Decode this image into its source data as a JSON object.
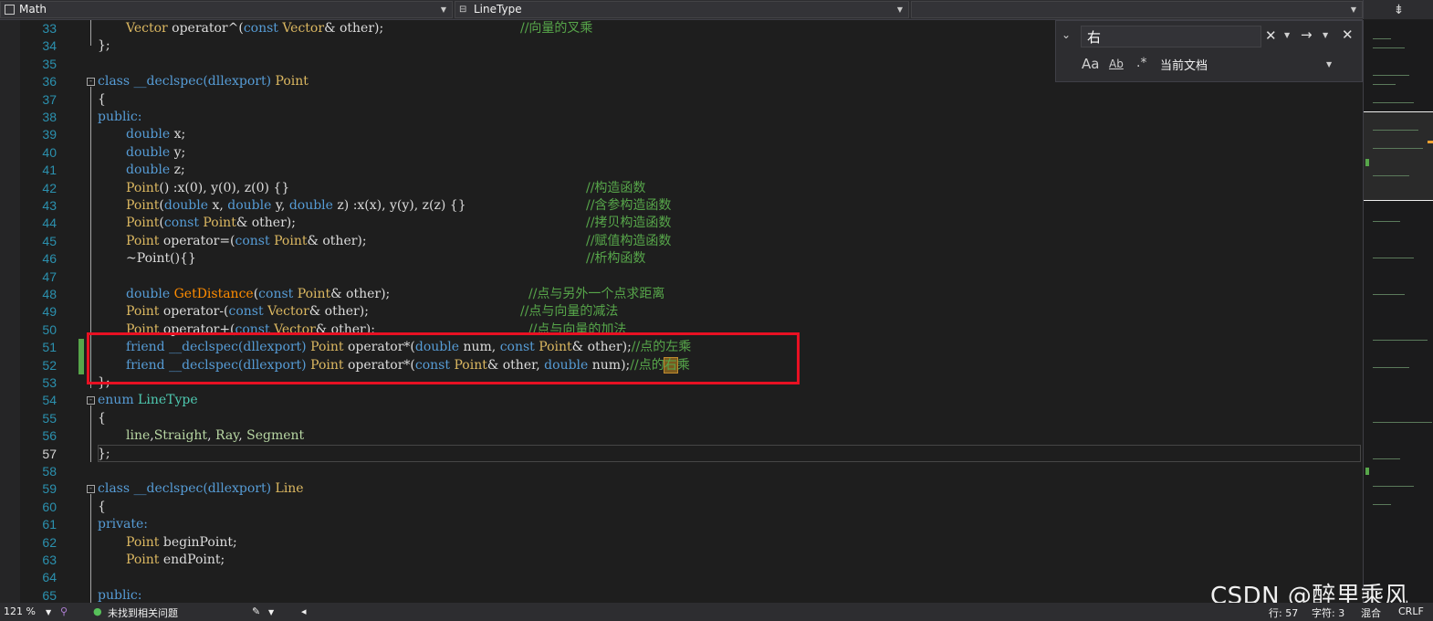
{
  "nav": {
    "left_dropdown": "Math",
    "middle_dropdown": "LineType"
  },
  "find": {
    "query": "右",
    "scope": "当前文档",
    "match_case_icon": "Aa",
    "match_word_icon": "Ab",
    "regex_icon": ".*"
  },
  "lines": [
    {
      "n": "33"
    },
    {
      "n": "34"
    },
    {
      "n": "35"
    },
    {
      "n": "36"
    },
    {
      "n": "37"
    },
    {
      "n": "38"
    },
    {
      "n": "39"
    },
    {
      "n": "40"
    },
    {
      "n": "41"
    },
    {
      "n": "42"
    },
    {
      "n": "43"
    },
    {
      "n": "44"
    },
    {
      "n": "45"
    },
    {
      "n": "46"
    },
    {
      "n": "47"
    },
    {
      "n": "48"
    },
    {
      "n": "49"
    },
    {
      "n": "50"
    },
    {
      "n": "51"
    },
    {
      "n": "52"
    },
    {
      "n": "53"
    },
    {
      "n": "54"
    },
    {
      "n": "55"
    },
    {
      "n": "56"
    },
    {
      "n": "57"
    },
    {
      "n": "58"
    },
    {
      "n": "59"
    },
    {
      "n": "60"
    },
    {
      "n": "61"
    },
    {
      "n": "62"
    },
    {
      "n": "63"
    },
    {
      "n": "64"
    },
    {
      "n": "65"
    }
  ],
  "code": {
    "l33": {
      "a": "Vector",
      "b": " operator^(",
      "c": "const ",
      "d": "Vector",
      "e": "& other);",
      "cm": "//向量的叉乘"
    },
    "l34": "};",
    "l36": {
      "kw": "class ",
      "mid": "__declspec(dllexport) ",
      "cls": "Point"
    },
    "l37": "{",
    "l38": "public:",
    "l39": {
      "kw": "double ",
      "v": "x;"
    },
    "l40": {
      "kw": "double ",
      "v": "y;"
    },
    "l41": {
      "kw": "double ",
      "v": "z;"
    },
    "l42": {
      "fn": "Point",
      "rest": "() :x(0), y(0), z(0) {}",
      "cm": "//构造函数"
    },
    "l43": {
      "fn": "Point",
      "p1": "(",
      "k1": "double ",
      "a": "x, ",
      "k2": "double ",
      "b": "y, ",
      "k3": "double ",
      "c": "z) :x(x), y(y), z(z) {}",
      "cm": "//含参构造函数"
    },
    "l44": {
      "fn": "Point",
      "p1": "(",
      "k1": "const ",
      "t": "Point",
      "rest": "& other);",
      "cm": "//拷贝构造函数"
    },
    "l45": {
      "t1": "Point",
      "mid": " operator=(",
      "k": "const ",
      "t2": "Point",
      "rest": "& other);",
      "cm": "//赋值构造函数"
    },
    "l46": {
      "rest": "~Point(){}",
      "cm": "//析构函数"
    },
    "l48": {
      "k": "double ",
      "fn": "GetDistance",
      "p": "(",
      "k2": "const ",
      "t": "Point",
      "rest": "& other);",
      "cm": "//点与另外一个点求距离"
    },
    "l49": {
      "t1": "Point",
      "mid": " operator-(",
      "k": "const ",
      "t2": "Vector",
      "rest": "& other);",
      "cm": "//点与向量的减法"
    },
    "l50": {
      "t1": "Point",
      "mid": " operator+(",
      "k": "const ",
      "t2": "Vector",
      "rest": "& other);",
      "cm": "//点与向量的加法"
    },
    "l51": {
      "k": "friend ",
      "m": "__declspec(dllexport) ",
      "t1": "Point",
      "mid": " operator*(",
      "k2": "double ",
      "a": "num, ",
      "k3": "const ",
      "t2": "Point",
      "rest": "& other);",
      "cm": "//点的左乘"
    },
    "l52": {
      "k": "friend ",
      "m": "__declspec(dllexport) ",
      "t1": "Point",
      "mid": " operator*(",
      "k2": "const ",
      "t2": "Point",
      "a": "& other, ",
      "k3": "double ",
      "rest": "num);",
      "cm1": "//点的",
      "hit": "右",
      "cm2": "乘"
    },
    "l53": "};",
    "l54": {
      "kw": "enum ",
      "cls": "LineType"
    },
    "l55": "{",
    "l56": {
      "e1": "line",
      "s1": ",",
      "e2": "Straight",
      "s2": ", ",
      "e3": "Ray",
      "s3": ", ",
      "e4": "Segment"
    },
    "l57": "};",
    "l59": {
      "kw": "class ",
      "mid": "__declspec(dllexport) ",
      "cls": "Line"
    },
    "l60": "{",
    "l61": "private:",
    "l62": {
      "t": "Point",
      "rest": " beginPoint;"
    },
    "l63": {
      "t": "Point",
      "rest": " endPoint;"
    },
    "l65": "public:"
  },
  "status": {
    "zoom": "121 %",
    "issues": "未找到相关问题",
    "line": "行: 57",
    "char": "字符: 3",
    "mode": "混合",
    "eol": "CRLF"
  },
  "watermark": "CSDN @醉里乘风",
  "colors": {
    "keyword": "#569cd6",
    "type": "#4ec9b0",
    "comment": "#57a64a",
    "highlight_box": "#e81123",
    "change_bar": "#57a64a"
  }
}
